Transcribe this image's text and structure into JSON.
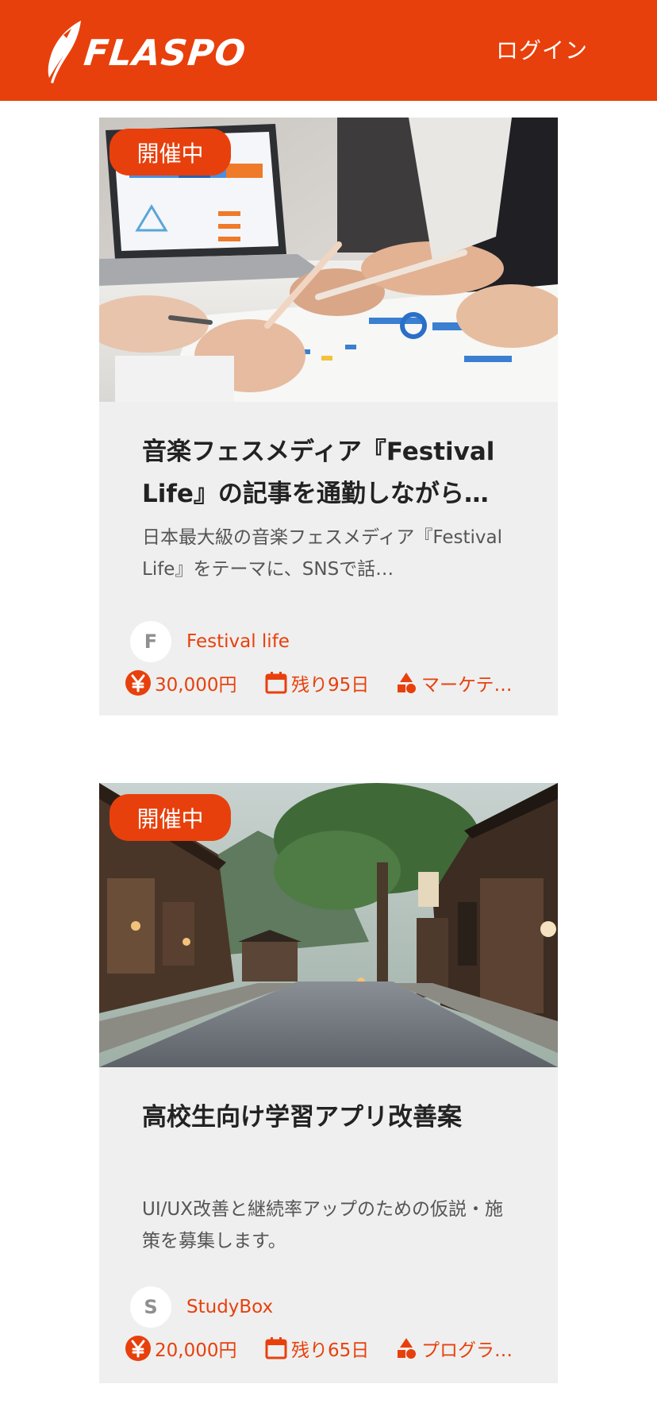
{
  "header": {
    "logo_text": "FLASPO",
    "login_label": "ログイン",
    "background_color": "#e8400c"
  },
  "cards": [
    {
      "badge": "開催中",
      "image": "business-meeting-photo",
      "title": "音楽フェスメディア『Festival Life』の記事を通勤しながら…",
      "description": "日本最大級の音楽フェスメディア『Festival Life』をテーマに、SNSで話…",
      "org_initial": "F",
      "org_name": "Festival life",
      "prize": "30,000円",
      "days_left": "残り95日",
      "category": "マーケテ…"
    },
    {
      "badge": "開催中",
      "image": "old-japanese-street-photo",
      "title": "高校生向け学習アプリ改善案",
      "description": "UI/UX改善と継続率アップのための仮説・施策を募集します。",
      "org_initial": "S",
      "org_name": "StudyBox",
      "prize": "20,000円",
      "days_left": "残り65日",
      "category": "プログラ…"
    }
  ],
  "icons": {
    "prize": "yen-circle-icon",
    "days": "calendar-icon",
    "category": "shapes-icon"
  },
  "colors": {
    "accent": "#e8400c",
    "card_background": "#efefef",
    "title_text": "#222222",
    "body_text": "#555555"
  }
}
